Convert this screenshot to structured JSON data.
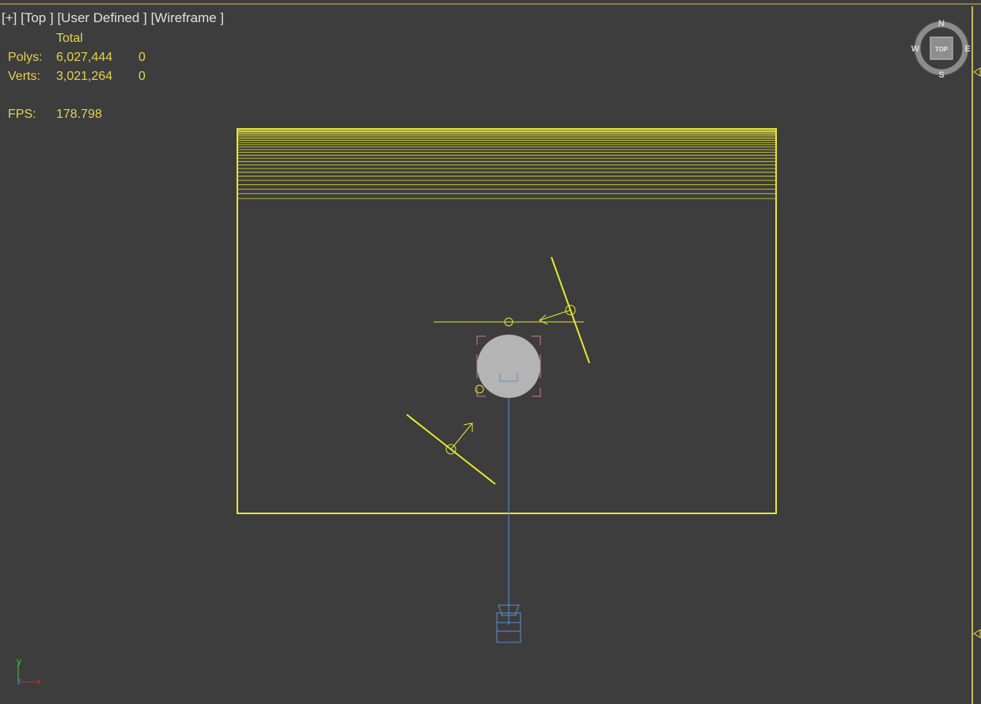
{
  "viewport": {
    "label_plus": "[+]",
    "label_view": "[Top ]",
    "label_shading": "[User Defined ]",
    "label_mode": "[Wireframe ]"
  },
  "stats": {
    "header_total": "Total",
    "polys_label": "Polys:",
    "polys_total": "6,027,444",
    "polys_sel": "0",
    "verts_label": "Verts:",
    "verts_total": "3,021,264",
    "verts_sel": "0",
    "fps_label": "FPS:",
    "fps_value": "178.798"
  },
  "viewcube": {
    "north": "N",
    "south": "S",
    "east": "E",
    "west": "W",
    "face": "TOP"
  },
  "axis_gizmo": {
    "y": "y",
    "z": "z",
    "x": "x"
  },
  "colors": {
    "background": "#3d3d3d",
    "wire_yellow": "#e8e830",
    "stats_yellow": "#e6d24a",
    "camera_blue": "#5a8fd8",
    "selection_pink": "#d07a9a",
    "sphere_gray": "#b4b4b4"
  }
}
